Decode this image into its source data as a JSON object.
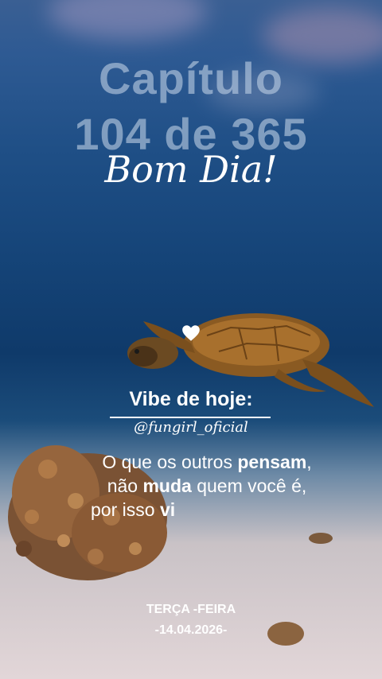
{
  "header": {
    "chapter_line1": "Capítulo",
    "chapter_line2": "104 de 365",
    "greeting": "Bom Dia!"
  },
  "icons": {
    "heart": "heart-icon"
  },
  "vibe": {
    "title": "Vibe de hoje:",
    "handle": "@fungirl_oficial"
  },
  "quote": {
    "l1_a": "O que os outros ",
    "l1_b": "pensam",
    "l1_c": ",",
    "l2_a": "não ",
    "l2_b": "muda",
    "l2_c": " quem você é,",
    "l3_a": "por isso ",
    "l3_b": "vi"
  },
  "footer": {
    "weekday": "TERÇA -FEIRA",
    "date": "-14.04.2026-"
  },
  "colors": {
    "title_text": "#bccde2",
    "text": "#ffffff"
  }
}
